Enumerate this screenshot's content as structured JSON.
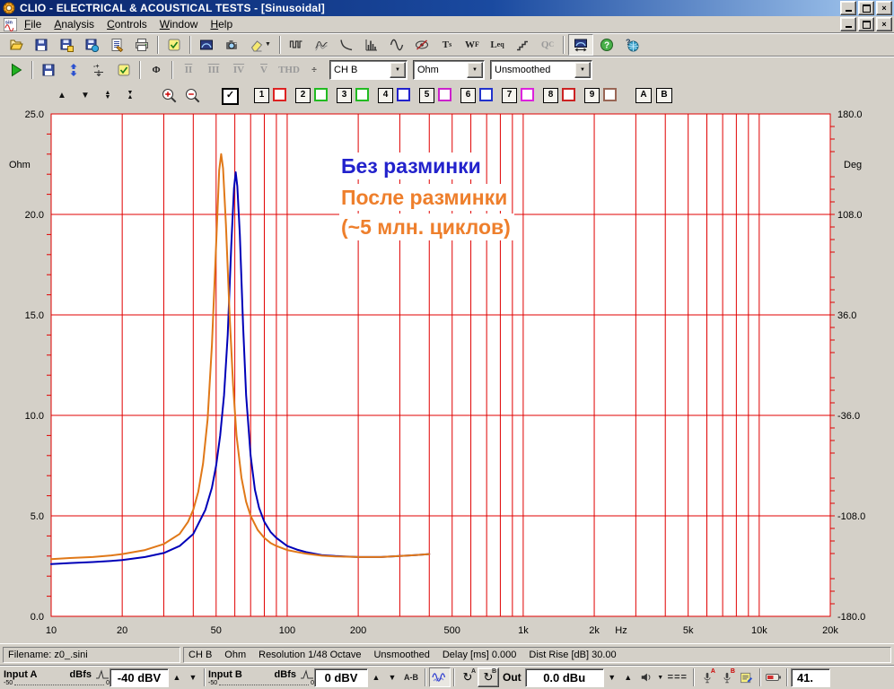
{
  "window": {
    "title": "CLIO - ELECTRICAL & ACOUSTICAL TESTS - [Sinusoidal]",
    "controls": [
      "minimize",
      "restore",
      "close"
    ],
    "child_controls": [
      "minimize",
      "restore",
      "close"
    ]
  },
  "menu": {
    "items": [
      "File",
      "Analysis",
      "Controls",
      "Window",
      "Help"
    ]
  },
  "toolbar_main": {
    "buttons": [
      {
        "icon": "open-file"
      },
      {
        "icon": "save-file"
      },
      {
        "icon": "save-as"
      },
      {
        "icon": "export-data"
      },
      {
        "icon": "export-report"
      },
      {
        "icon": "print"
      },
      {
        "sep": true
      },
      {
        "icon": "options"
      },
      {
        "sep": true
      },
      {
        "icon": "autoscale"
      },
      {
        "icon": "snapshot"
      },
      {
        "icon": "delete-overlays",
        "dropdown": true
      },
      {
        "sep": true
      },
      {
        "icon": "mls-analysis"
      },
      {
        "icon": "waterfall-analysis"
      },
      {
        "icon": "decay-analysis"
      },
      {
        "icon": "fft-analysis"
      },
      {
        "icon": "sinusoidal-analysis"
      },
      {
        "icon": "fft-live-off"
      },
      {
        "label": "T",
        "sub": "s",
        "icon": "ts-parameters"
      },
      {
        "label": "W",
        "sub": "F",
        "icon": "waterfall-direct"
      },
      {
        "label": "L",
        "sub": "eq",
        "icon": "leq-analysis"
      },
      {
        "icon": "linearity-steps"
      },
      {
        "label": "Q",
        "sub": "C",
        "icon": "quality-control",
        "disabled": true
      },
      {
        "sep": true
      },
      {
        "icon": "measurement-size",
        "pressed": true
      },
      {
        "icon": "help"
      },
      {
        "icon": "online-help"
      }
    ]
  },
  "toolbar_meas": {
    "buttons": [
      {
        "icon": "start-measurement"
      },
      {
        "sep": true
      },
      {
        "icon": "save-current"
      },
      {
        "icon": "vertical-scale"
      },
      {
        "icon": "scale-adjust"
      },
      {
        "icon": "meas-settings"
      },
      {
        "sep": true
      },
      {
        "icon": "phase-display",
        "label": "Φ"
      },
      {
        "sep": true
      },
      {
        "label": "II",
        "disabled": true,
        "roman": true
      },
      {
        "label": "III",
        "disabled": true,
        "roman": true
      },
      {
        "label": "IV",
        "disabled": true,
        "roman": true
      },
      {
        "label": "V",
        "disabled": true,
        "roman": true
      },
      {
        "label": "THD",
        "disabled": true
      },
      {
        "icon": "divide-scale",
        "label": "÷"
      }
    ],
    "combos": [
      {
        "name": "channel-select",
        "value": "CH B",
        "width": 85
      },
      {
        "name": "unit-select",
        "value": "Ohm",
        "width": 78
      },
      {
        "name": "smoothing-select",
        "value": "Unsmoothed",
        "width": 112
      }
    ]
  },
  "graph_controls": {
    "nav": [
      "scale-up",
      "scale-down",
      "scale-expand",
      "scale-compress",
      "zoom-in",
      "zoom-out"
    ],
    "master_checked": true,
    "check_glyph": "✓",
    "slots": [
      {
        "label": "1",
        "color": "#dd2222"
      },
      {
        "label": "2",
        "color": "#22bb22"
      },
      {
        "label": "3",
        "color": "#22bb22"
      },
      {
        "label": "4",
        "color": "#2222cc"
      },
      {
        "label": "5",
        "color": "#cc22cc"
      },
      {
        "label": "6",
        "color": "#2233cc"
      },
      {
        "label": "7",
        "color": "#dd22dd"
      },
      {
        "label": "8",
        "color": "#cc2222"
      },
      {
        "label": "9",
        "color": "#996655"
      }
    ],
    "ab": [
      "A",
      "B"
    ]
  },
  "chart_data": {
    "type": "line",
    "x_scale": "log",
    "xlim": [
      10,
      20000
    ],
    "xticks": [
      {
        "f": 10,
        "label": "10"
      },
      {
        "f": 20,
        "label": "20"
      },
      {
        "f": 50,
        "label": "50"
      },
      {
        "f": 100,
        "label": "100"
      },
      {
        "f": 200,
        "label": "200"
      },
      {
        "f": 500,
        "label": "500"
      },
      {
        "f": 1000,
        "label": "1k"
      },
      {
        "f": 2000,
        "label": "2k"
      },
      {
        "f": 5000,
        "label": "5k"
      },
      {
        "f": 10000,
        "label": "10k"
      },
      {
        "f": 20000,
        "label": "20k"
      }
    ],
    "xunit": {
      "label": "Hz",
      "f": 2600
    },
    "y_left": {
      "label": "Ohm",
      "min": 0,
      "max": 25,
      "ticks": [
        "25.0",
        "20.0",
        "15.0",
        "10.0",
        "5.0",
        "0.0"
      ]
    },
    "y_right": {
      "label": "Deg",
      "min": -180,
      "max": 180,
      "ticks": [
        "180.0",
        "108.0",
        "36.0",
        "-36.0",
        "-108.0",
        "-180.0"
      ]
    },
    "grid_on": true,
    "grid_color": "#e00000",
    "series": [
      {
        "name": "Без разминки",
        "color": "#0000b8",
        "points": [
          [
            10,
            2.6
          ],
          [
            12,
            2.65
          ],
          [
            15,
            2.7
          ],
          [
            18,
            2.76
          ],
          [
            20,
            2.8
          ],
          [
            25,
            2.95
          ],
          [
            30,
            3.15
          ],
          [
            35,
            3.5
          ],
          [
            40,
            4.1
          ],
          [
            45,
            5.3
          ],
          [
            48,
            6.4
          ],
          [
            50,
            7.5
          ],
          [
            52,
            9.0
          ],
          [
            54,
            11.0
          ],
          [
            56,
            14.0
          ],
          [
            58,
            18.5
          ],
          [
            59.5,
            21.3
          ],
          [
            60.5,
            22.1
          ],
          [
            61.5,
            21.4
          ],
          [
            63,
            19.0
          ],
          [
            65,
            14.5
          ],
          [
            67,
            11.0
          ],
          [
            70,
            8.0
          ],
          [
            73,
            6.3
          ],
          [
            76,
            5.4
          ],
          [
            80,
            4.7
          ],
          [
            85,
            4.2
          ],
          [
            90,
            3.9
          ],
          [
            100,
            3.5
          ],
          [
            110,
            3.32
          ],
          [
            120,
            3.2
          ],
          [
            140,
            3.05
          ],
          [
            160,
            3.0
          ],
          [
            200,
            2.95
          ],
          [
            250,
            2.95
          ],
          [
            300,
            3.0
          ],
          [
            350,
            3.05
          ],
          [
            400,
            3.1
          ]
        ]
      },
      {
        "name": "После разминки (~5 млн. циклов)",
        "color": "#e07818",
        "points": [
          [
            10,
            2.85
          ],
          [
            12,
            2.9
          ],
          [
            15,
            2.95
          ],
          [
            18,
            3.03
          ],
          [
            20,
            3.1
          ],
          [
            25,
            3.3
          ],
          [
            30,
            3.6
          ],
          [
            35,
            4.1
          ],
          [
            38,
            4.7
          ],
          [
            40,
            5.3
          ],
          [
            42,
            6.2
          ],
          [
            44,
            7.6
          ],
          [
            46,
            9.8
          ],
          [
            48,
            13.5
          ],
          [
            50,
            18.5
          ],
          [
            51.5,
            22.2
          ],
          [
            52.5,
            23.0
          ],
          [
            53.5,
            22.3
          ],
          [
            55,
            19.5
          ],
          [
            57,
            15.0
          ],
          [
            59,
            11.5
          ],
          [
            61,
            9.0
          ],
          [
            64,
            6.9
          ],
          [
            67,
            5.7
          ],
          [
            70,
            5.0
          ],
          [
            75,
            4.3
          ],
          [
            80,
            3.9
          ],
          [
            85,
            3.65
          ],
          [
            90,
            3.5
          ],
          [
            100,
            3.3
          ],
          [
            110,
            3.2
          ],
          [
            120,
            3.12
          ],
          [
            140,
            3.02
          ],
          [
            160,
            2.98
          ],
          [
            200,
            2.95
          ],
          [
            250,
            2.95
          ],
          [
            300,
            3.0
          ],
          [
            350,
            3.05
          ],
          [
            400,
            3.1
          ]
        ]
      }
    ],
    "annotations": [
      {
        "text": "Без разминки",
        "color": "#2222cc"
      },
      {
        "text": "После разминки",
        "color": "#ee7f2c"
      },
      {
        "text": "(~5 млн. циклов)",
        "color": "#ee7f2c"
      }
    ]
  },
  "statusbar": {
    "filename": "Filename: z0_.sini",
    "info_parts": [
      "CH B",
      "Ohm",
      "Resolution 1/48 Octave",
      "Unsmoothed",
      "Delay [ms] 0.000",
      "Dist Rise [dB] 30.00"
    ]
  },
  "io_bar": {
    "input_a": {
      "label": "Input A",
      "unit": "dBfs",
      "scale_min": "-50",
      "scale_max": "0",
      "value": "-40 dBV"
    },
    "input_b": {
      "label": "Input B",
      "unit": "dBfs",
      "scale_min": "-50",
      "scale_max": "0",
      "value": "0 dBV"
    },
    "ab_label": "A-B",
    "out_label": "Out",
    "out_value": "0.0 dBu",
    "eq_label": "===",
    "sample_rate": "41."
  }
}
